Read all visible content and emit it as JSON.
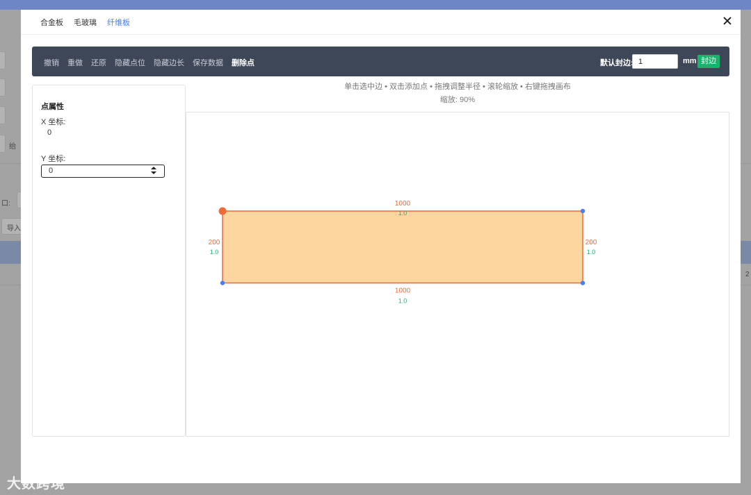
{
  "background": {
    "import_label": "导入",
    "right_value": "2",
    "left_text_a": "口:",
    "left_text_b": "绐"
  },
  "tabs": [
    {
      "label": "合金板",
      "active": false
    },
    {
      "label": "毛玻璃",
      "active": false
    },
    {
      "label": "纤维板",
      "active": true
    }
  ],
  "toolbar": {
    "undo": "撤销",
    "redo": "重做",
    "restore": "还原",
    "hide_points": "隐藏点位",
    "hide_edge_lengths": "隐藏边长",
    "save_data": "保存数据",
    "delete_point": "删除点",
    "default_edge_label": "默认封边:",
    "default_edge_value": "1",
    "unit": "mm",
    "seal_button": "封边"
  },
  "properties": {
    "title": "点属性",
    "x_label": "X 坐标:",
    "x_value": "0",
    "y_label": "Y 坐标:",
    "y_value": "0"
  },
  "hints": {
    "instructions": "单击选中边 • 双击添加点 • 拖拽调整半径 • 滚轮缩放 • 右键拖拽画布",
    "zoom": "缩放: 90%"
  },
  "shape": {
    "width": 1000,
    "height": 200,
    "edges": [
      {
        "name": "top",
        "length": "1000",
        "seal": "1.0"
      },
      {
        "name": "right",
        "length": "200",
        "seal": "1.0"
      },
      {
        "name": "bottom",
        "length": "1000",
        "seal": "1.0"
      },
      {
        "name": "left",
        "length": "200",
        "seal": "1.0"
      }
    ],
    "selected_point": "top-left",
    "fill_color": "#fdd59f",
    "stroke_color": "#f06a38",
    "point_color": "#4a7dfd",
    "length_color": "#f06a38",
    "seal_color": "#18b46e"
  },
  "watermark": "大数跨境"
}
